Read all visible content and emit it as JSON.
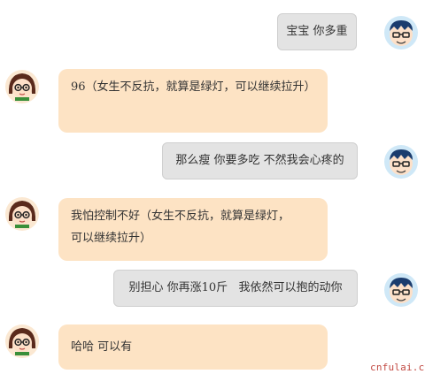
{
  "messages": [
    {
      "side": "right",
      "text": "宝宝 你多重"
    },
    {
      "side": "left",
      "text": "96（女生不反抗，就算是绿灯，可以继续拉升）"
    },
    {
      "side": "right",
      "text": "那么瘦 你要多吃 不然我会心疼的"
    },
    {
      "side": "left",
      "text": "我怕控制不好（女生不反抗，就算是绿灯，\n可以继续拉升）"
    },
    {
      "side": "right",
      "text": "别担心 你再涨10斤   我依然可以抱的动你"
    },
    {
      "side": "left",
      "text": "哈哈 可以有"
    }
  ],
  "watermark": "cnfulai.cn"
}
